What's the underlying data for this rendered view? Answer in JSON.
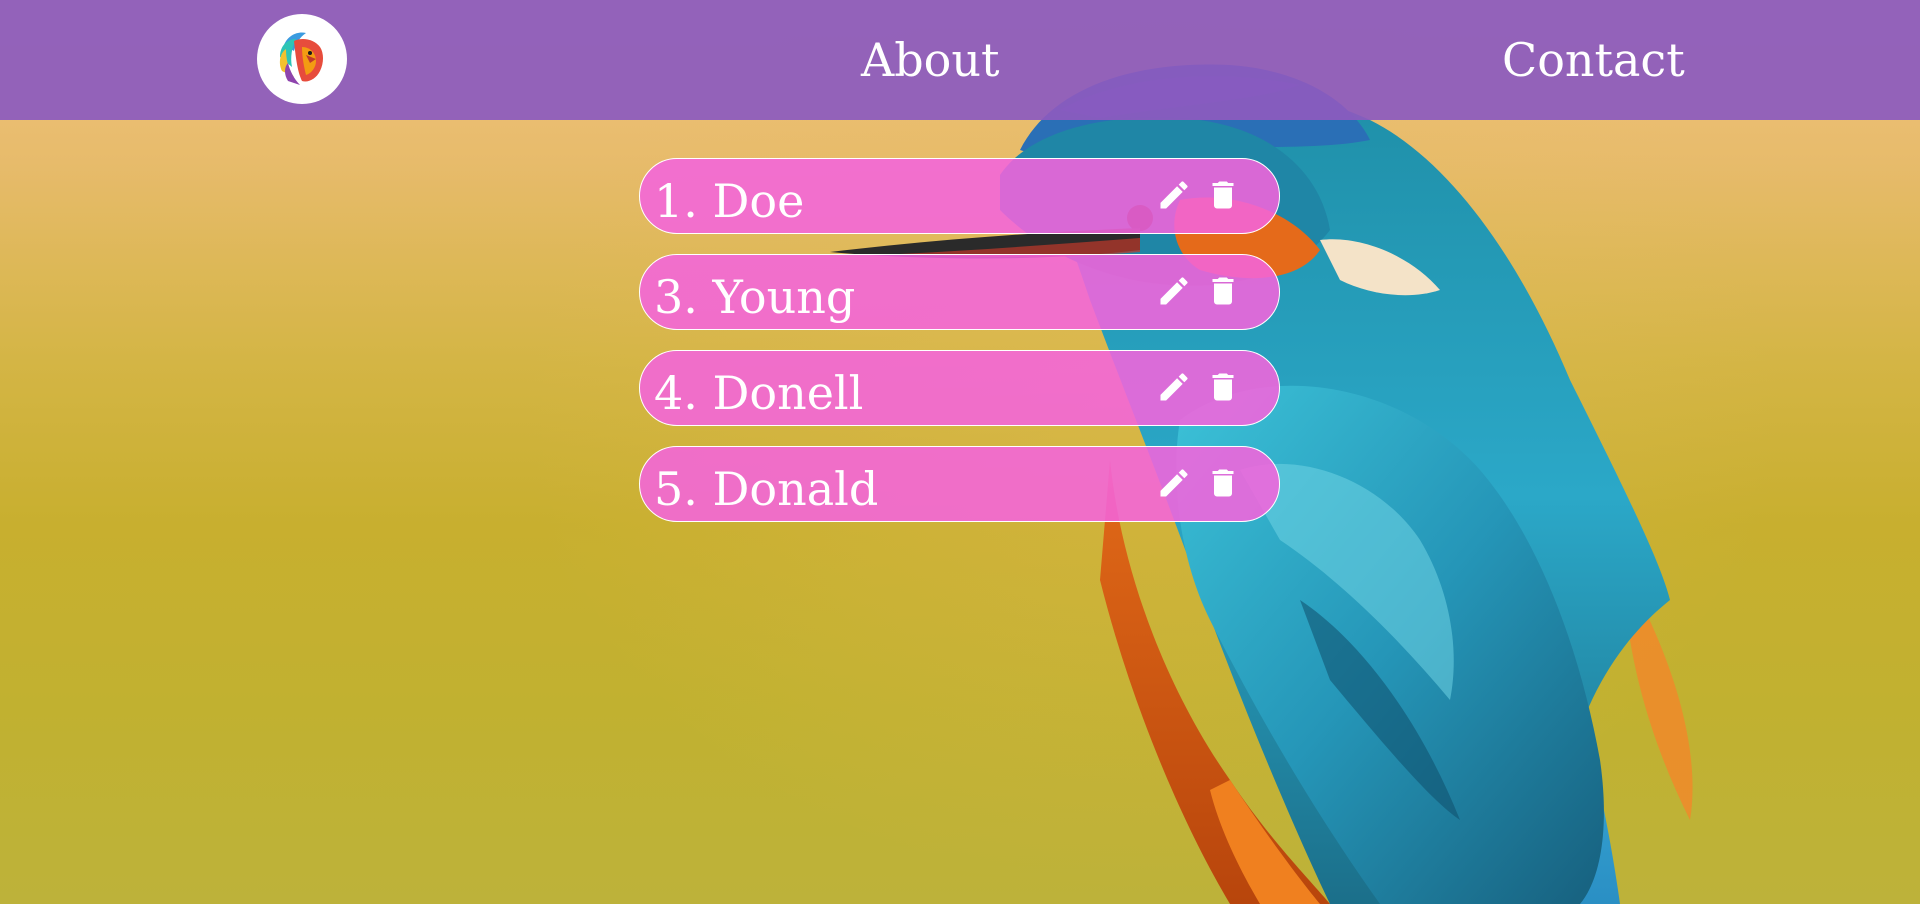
{
  "navbar": {
    "logo_icon": "lion-head-logo-icon",
    "links": [
      {
        "label": "About"
      },
      {
        "label": "Contact"
      }
    ]
  },
  "list": {
    "items": [
      {
        "label": "1. Doe",
        "edit_icon": "pencil-icon",
        "delete_icon": "trash-icon"
      },
      {
        "label": "3. Young",
        "edit_icon": "pencil-icon",
        "delete_icon": "trash-icon"
      },
      {
        "label": "4. Donell",
        "edit_icon": "pencil-icon",
        "delete_icon": "trash-icon"
      },
      {
        "label": "5. Donald",
        "edit_icon": "pencil-icon",
        "delete_icon": "trash-icon"
      }
    ]
  },
  "colors": {
    "navbar": "#8c5abe",
    "list_item": "#f464dc",
    "text": "#ffffff"
  }
}
